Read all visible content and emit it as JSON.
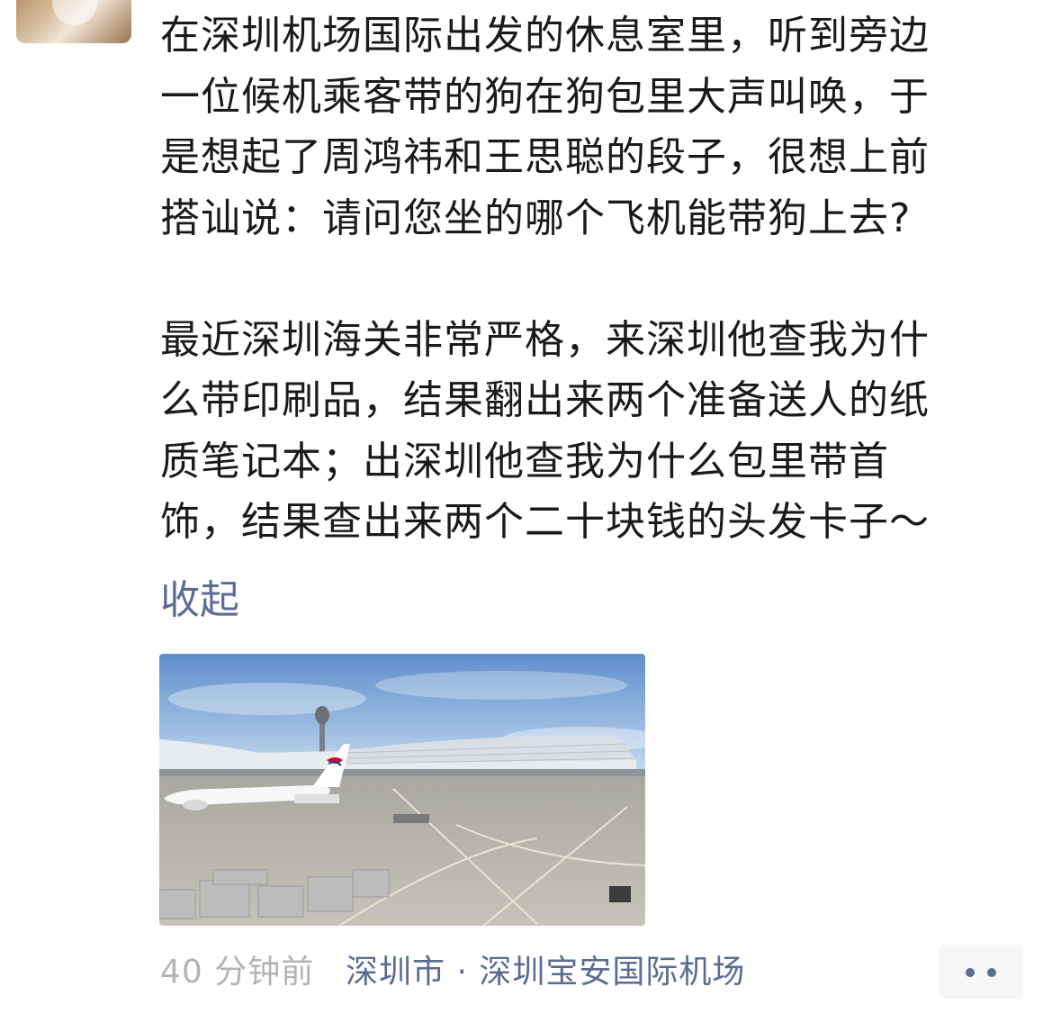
{
  "post": {
    "paragraph1": [
      "在深圳机场国际出发的休息室里，听到旁边",
      "一位候机乘客带的狗在狗包里大声叫唤，于",
      "是想起了周鸿祎和王思聪的段子，很想上前",
      "搭讪说：请问您坐的哪个飞机能带狗上去?"
    ],
    "paragraph2": [
      "最近深圳海关非常严格，来深圳他查我为什",
      "么带印刷品，结果翻出来两个准备送人的纸",
      "质笔记本；出深圳他查我为什么包里带首",
      "饰，结果查出来两个二十块钱的头发卡子～"
    ],
    "collapse_label": "收起"
  },
  "meta": {
    "time": "40 分钟前",
    "location": "深圳市 · 深圳宝安国际机场"
  },
  "colors": {
    "text": "#1a1a1a",
    "link": "#5b6b92",
    "time": "#b3b3b3",
    "more_button_bg": "#f6f6f6"
  },
  "icons": {
    "more": "more-dots-icon"
  }
}
